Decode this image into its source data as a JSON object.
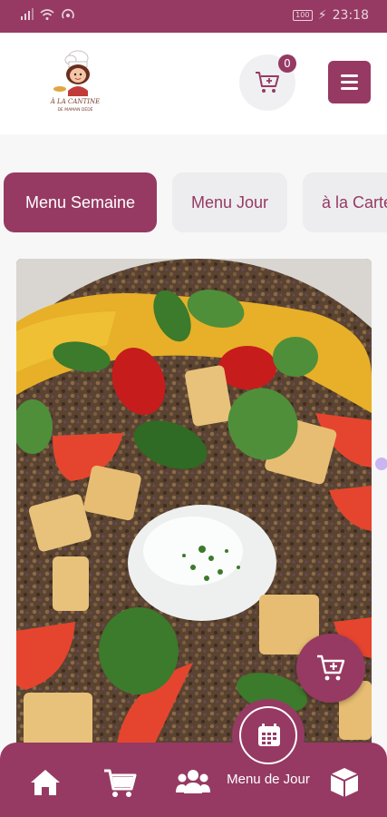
{
  "status_bar": {
    "left_icons": [
      "signal-icon",
      "wifi-icon",
      "hotspot-icon"
    ],
    "battery": "100",
    "time": "23:18"
  },
  "header": {
    "logo_text_line1": "À LA CANTINE",
    "logo_text_line2": "DE MAMAN DÉDÉ",
    "cart_count": "0"
  },
  "tabs": [
    {
      "label": "Menu Semaine",
      "active": true
    },
    {
      "label": "Menu Jour",
      "active": false
    },
    {
      "label": "à la Carte",
      "active": false
    }
  ],
  "bottom_nav": {
    "items": [
      "home-icon",
      "cart-icon",
      "users-icon",
      "calendar-icon",
      "box-icon"
    ],
    "center_label": "Menu de Jour"
  },
  "colors": {
    "brand": "#963a63",
    "tab_inactive_bg": "#ededf0",
    "header_bg": "#ffffff"
  }
}
